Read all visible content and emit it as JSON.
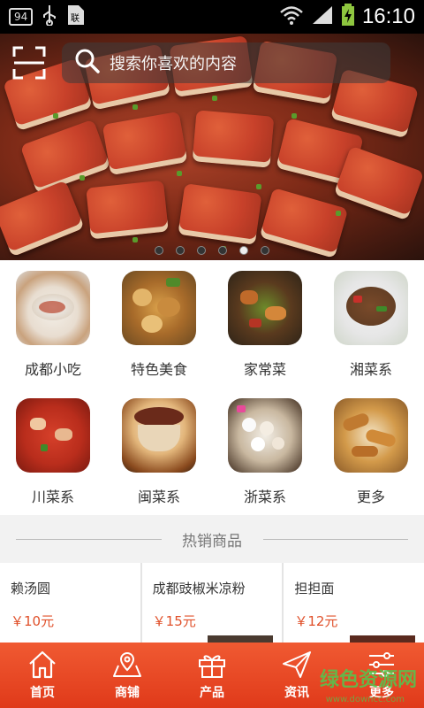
{
  "status_bar": {
    "notification": "94",
    "time": "16:10",
    "icons": [
      "usb-icon",
      "sim-icon",
      "wifi-icon",
      "signal-icon",
      "battery-icon"
    ]
  },
  "banner": {
    "search_placeholder": "搜索你喜欢的内容",
    "dot_count": 6,
    "active_dot": 5
  },
  "categories": [
    {
      "label": "成都小吃",
      "icon": "chengdu-snack"
    },
    {
      "label": "特色美食",
      "icon": "special-food"
    },
    {
      "label": "家常菜",
      "icon": "home-dish"
    },
    {
      "label": "湘菜系",
      "icon": "hunan-cuisine"
    },
    {
      "label": "川菜系",
      "icon": "sichuan-cuisine"
    },
    {
      "label": "闽菜系",
      "icon": "fujian-cuisine"
    },
    {
      "label": "浙菜系",
      "icon": "zhejiang-cuisine"
    },
    {
      "label": "更多",
      "icon": "more"
    }
  ],
  "hot": {
    "title": "热销商品",
    "products": [
      {
        "name": "赖汤圆",
        "price": "￥10元"
      },
      {
        "name": "成都豉椒米凉粉",
        "price": "￥15元"
      },
      {
        "name": "担担面",
        "price": "￥12元"
      }
    ]
  },
  "nav": [
    {
      "label": "首页",
      "icon": "home-icon"
    },
    {
      "label": "商铺",
      "icon": "map-icon"
    },
    {
      "label": "产品",
      "icon": "gift-icon"
    },
    {
      "label": "资讯",
      "icon": "send-icon"
    },
    {
      "label": "更多",
      "icon": "settings-icon"
    }
  ],
  "watermark": "绿色资源网",
  "watermark_sub": "www.downcc.com",
  "colors": {
    "accent": "#e84a24",
    "price": "#e0502a"
  }
}
